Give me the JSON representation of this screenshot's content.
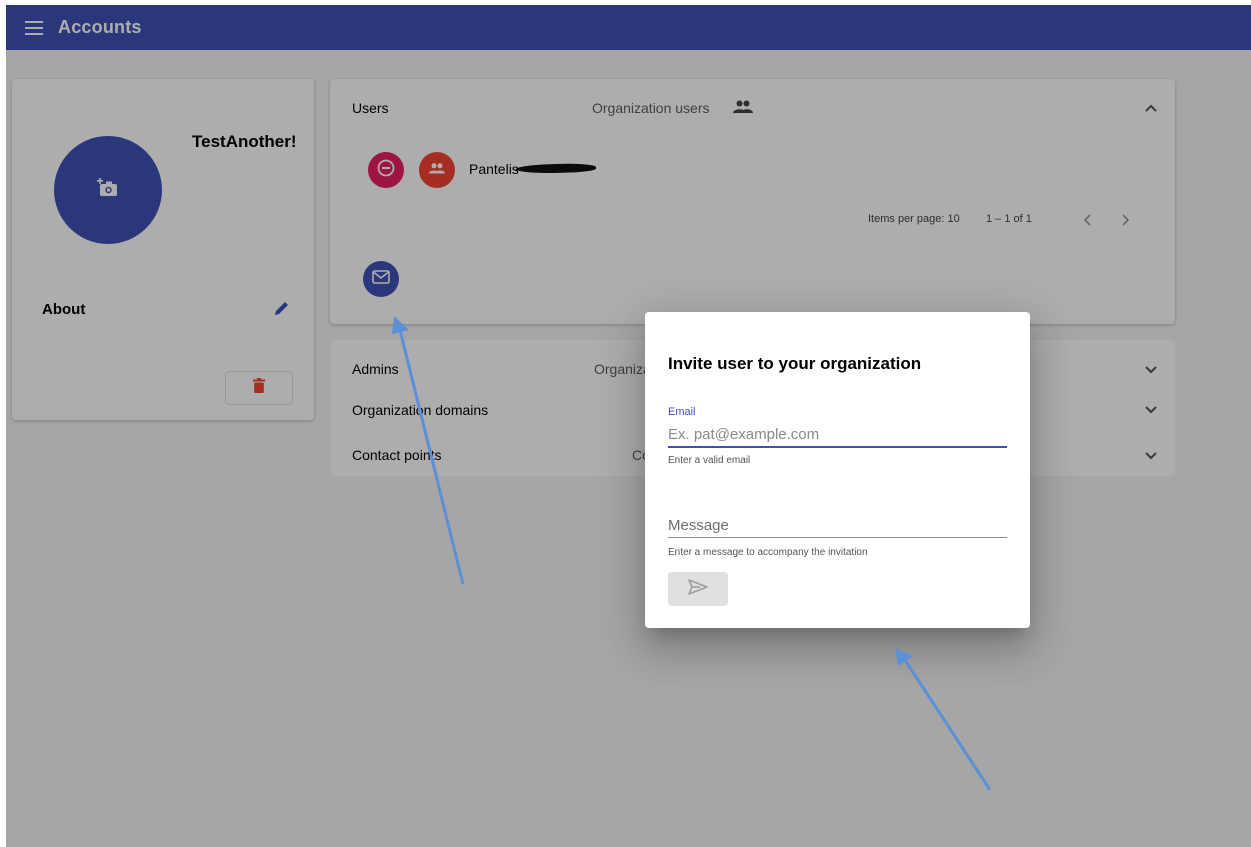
{
  "toolbar": {
    "title": "Accounts",
    "menu_icon": "menu-icon"
  },
  "profile": {
    "name": "TestAnother!",
    "about_label": "About",
    "avatar_icon": "add-photo-icon",
    "edit_icon": "pencil-icon",
    "delete_icon": "trash-icon"
  },
  "users_panel": {
    "title": "Users",
    "description": "Organization users",
    "description_icon": "people-icon",
    "expanded": true,
    "members": [
      {
        "name": "Pantelis",
        "remove_icon": "remove-circle-icon",
        "role_icon": "group-icon"
      }
    ],
    "paginator": {
      "items_per_page_label": "Items per page:",
      "items_per_page": "10",
      "range": "1 – 1 of 1"
    },
    "invite_icon": "mail-icon"
  },
  "collapsed_panels": [
    {
      "title": "Admins",
      "description": "Organiza"
    },
    {
      "title": "Organization domains",
      "description": ""
    },
    {
      "title": "Contact points",
      "description": "Co"
    }
  ],
  "dialog": {
    "title": "Invite user to your organization",
    "email_label": "Email",
    "email_placeholder": "Ex. pat@example.com",
    "email_value": "",
    "email_hint": "Enter a valid email",
    "message_placeholder": "Message",
    "message_value": "",
    "message_hint": "Enter a message to accompany the invitation",
    "send_icon": "send-icon",
    "send_enabled": false
  },
  "colors": {
    "primary": "#3f51b5",
    "accent_pink": "#e91e63",
    "warn_red": "#f44336",
    "annotation_arrow": "#5b8fd6"
  }
}
